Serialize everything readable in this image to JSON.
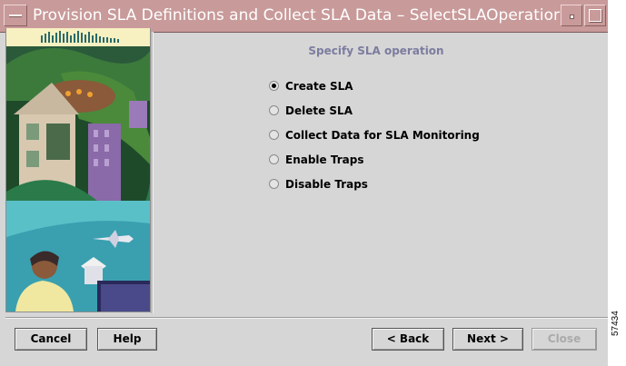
{
  "window": {
    "title": "Provision SLA Definitions and Collect SLA Data – SelectSLAOperation",
    "controls": [
      "window-menu-icon",
      "minimize-icon",
      "maximize-icon"
    ]
  },
  "main": {
    "heading": "Specify SLA operation",
    "options": [
      {
        "label": "Create SLA",
        "selected": true
      },
      {
        "label": "Delete SLA",
        "selected": false
      },
      {
        "label": "Collect Data for SLA Monitoring",
        "selected": false
      },
      {
        "label": "Enable Traps",
        "selected": false
      },
      {
        "label": "Disable Traps",
        "selected": false
      }
    ]
  },
  "buttons": {
    "cancel": "Cancel",
    "help": "Help",
    "back": "< Back",
    "next": "Next >",
    "close": "Close",
    "close_enabled": false
  },
  "figure_ref": "57434",
  "colors": {
    "titlebar": "#c99a9a",
    "dialog_bg": "#d6d6d6",
    "heading": "#7c7ca0"
  }
}
